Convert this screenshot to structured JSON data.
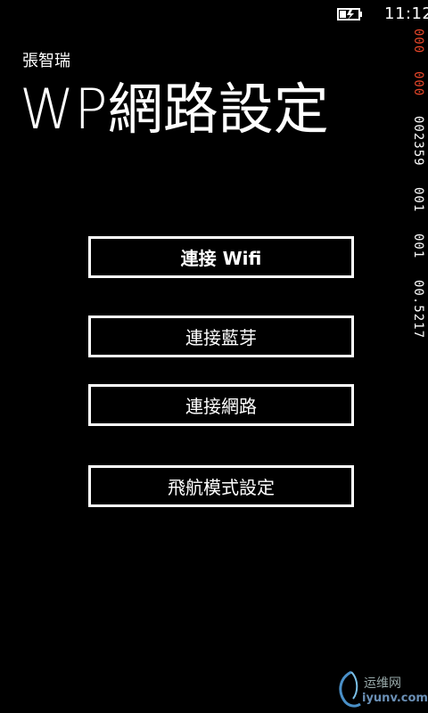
{
  "status_bar": {
    "battery_icon": "battery-charging-icon",
    "time": "11:12"
  },
  "counters": [
    {
      "text": "000",
      "color": "#e8472a"
    },
    {
      "text": "000",
      "color": "#e8472a"
    },
    {
      "text": "002359",
      "color": "#ffffff"
    },
    {
      "text": "001",
      "color": "#ffffff"
    },
    {
      "text": "001",
      "color": "#ffffff"
    },
    {
      "text": "00.5217",
      "color": "#ffffff"
    }
  ],
  "header": {
    "app_name": "張智瑞",
    "page_title": "WP網路設定"
  },
  "buttons": {
    "wifi": "連接 Wifi",
    "bluetooth": "連接藍芽",
    "network": "連接網路",
    "airplane": "飛航模式設定"
  },
  "watermark": {
    "cn": "运维网",
    "url": "iyunv.com"
  },
  "colors": {
    "background": "#000000",
    "foreground": "#ffffff",
    "counter_accent": "#e8472a"
  }
}
